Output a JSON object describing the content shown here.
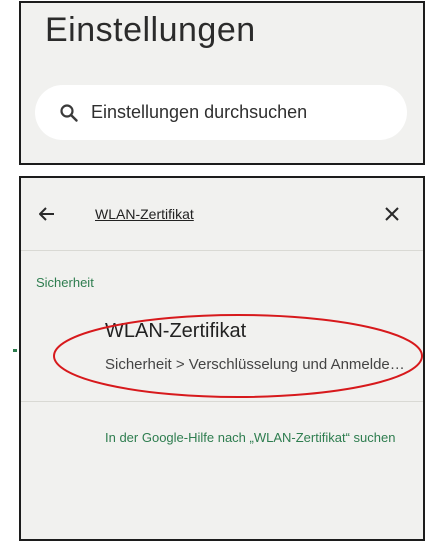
{
  "header": {
    "title": "Einstellungen",
    "search_placeholder": "Einstellungen durchsuchen",
    "search_icon": "search-icon"
  },
  "search_results": {
    "back_icon": "arrow-left-icon",
    "query": "WLAN-Zertifikat",
    "close_icon": "close-icon",
    "section_label": "Sicherheit",
    "items": [
      {
        "title": "WLAN-Zertifikat",
        "path": "Sicherheit > Verschlüsselung und Anmeldedaten"
      }
    ],
    "help_link": "In der Google-Hilfe nach „WLAN-Zertifikat“ suchen"
  },
  "colors": {
    "panel_bg": "#f1f1ef",
    "accent_green": "#2e7d4f",
    "highlight_red": "#d7191c"
  }
}
